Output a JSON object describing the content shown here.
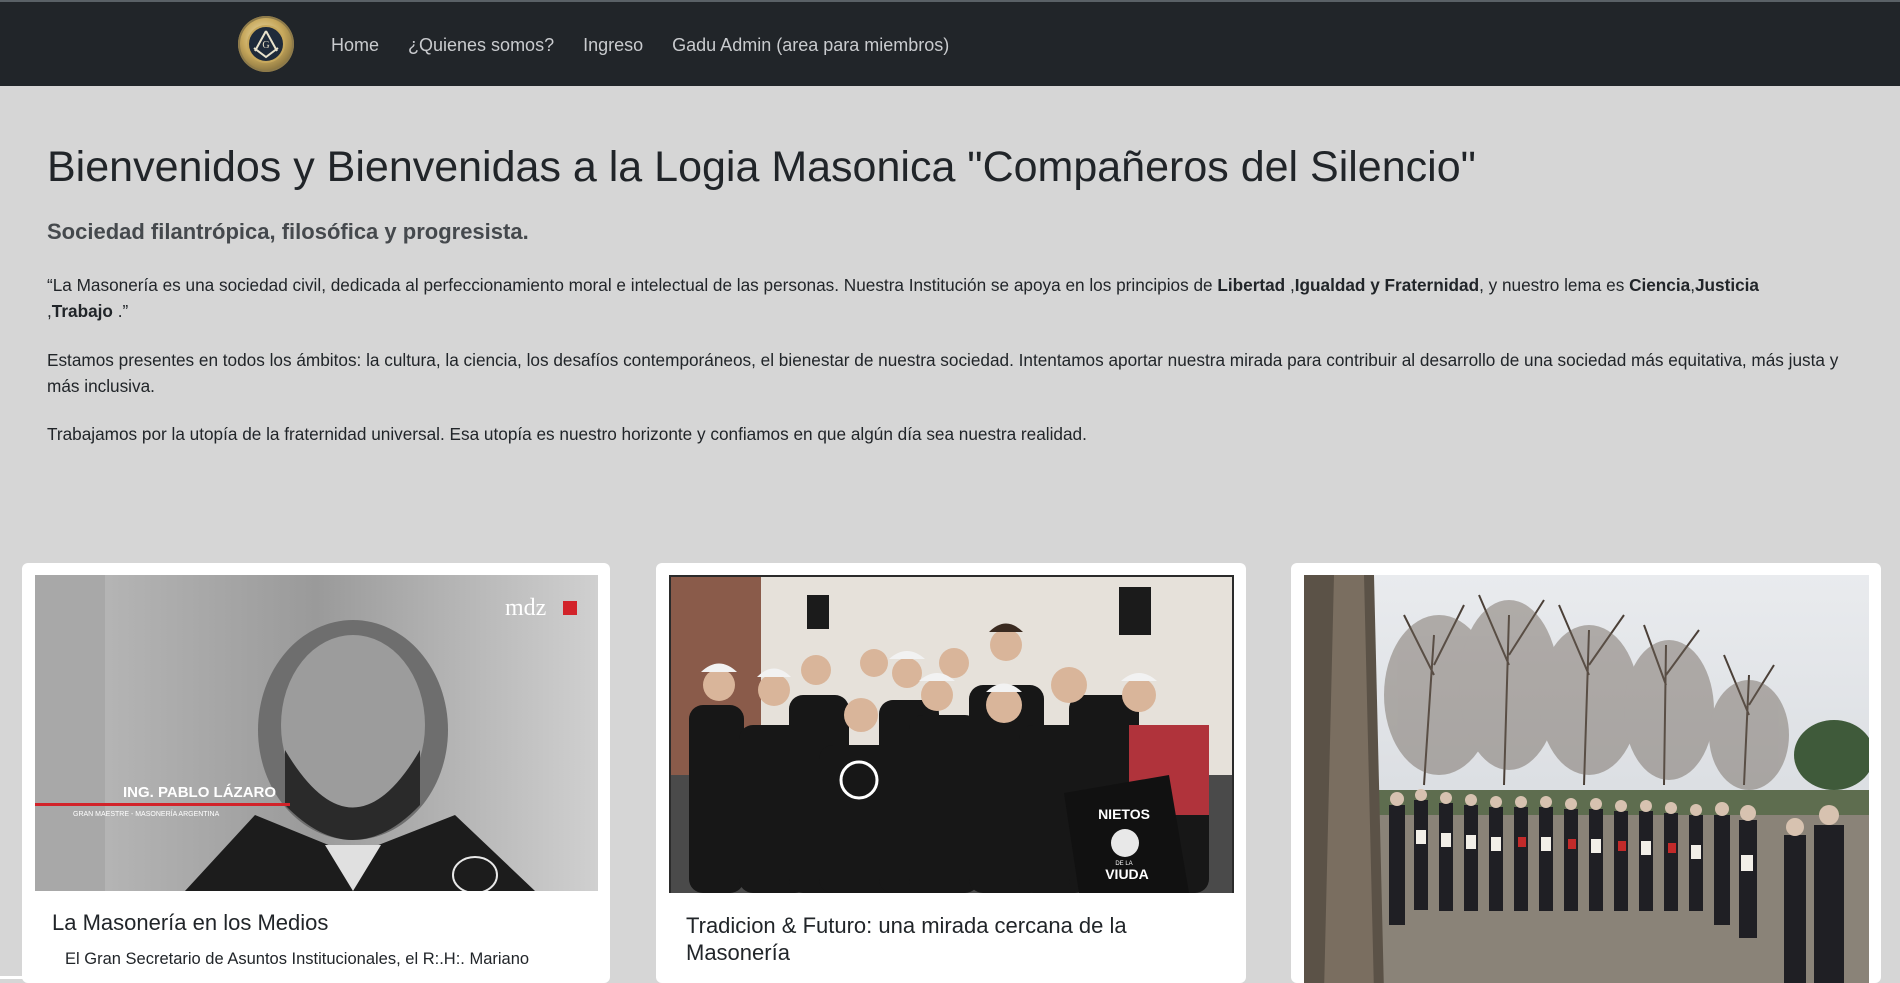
{
  "nav": {
    "items": [
      "Home",
      "¿Quienes somos?",
      "Ingreso",
      "Gadu Admin (area para miembros)"
    ]
  },
  "hero": {
    "title": "Bienvenidos y Bienvenidas a la Logia Masonica \"Compañeros del Silencio\"",
    "subtitle": "Sociedad filantrópica, filosófica y progresista.",
    "p1": {
      "a": "“La Masonería es una sociedad civil, dedicada al perfeccionamiento moral e intelectual de las personas. Nuestra Institución se apoya en los principios de ",
      "b1": "Libertad",
      "c": " ,",
      "b2": "Igualdad y Fraternidad",
      "d": ", y nuestro lema es ",
      "b3": "Ciencia",
      "e": ",",
      "b4": "Justicia",
      "f": " ,",
      "b5": "Trabajo",
      "g": " .”"
    },
    "p2": "Estamos presentes en todos los ámbitos: la cultura, la ciencia, los desafíos contemporáneos, el bienestar de nuestra sociedad. Intentamos aportar nuestra mirada para contribuir al desarrollo de una sociedad más equitativa, más justa y más inclusiva.",
    "p3": "Trabajamos por la utopía de la fraternidad universal. Esa utopía es nuestro horizonte y confiamos en que algún día sea nuestra realidad."
  },
  "cards": [
    {
      "title": "La Masonería en los Medios",
      "text": "El Gran Secretario de Asuntos Institucionales, el R:.H:. Mariano",
      "image_caption_name": "ING. PABLO LÁZARO",
      "image_caption_role": "GRAN MAESTRE - MASONERÍA ARGENTINA",
      "image_logo": "mdz"
    },
    {
      "title": "Tradicion & Futuro: una mirada cercana de la Masonería",
      "shirt_text_top": "NIETOS",
      "shirt_text_bottom": "VIUDA",
      "shirt_text_mid": "DE LA"
    },
    {
      "title": ""
    }
  ],
  "colors": {
    "navbar": "#212529",
    "page_bg": "#d6d6d6",
    "nav_link": "#c9cbce"
  }
}
